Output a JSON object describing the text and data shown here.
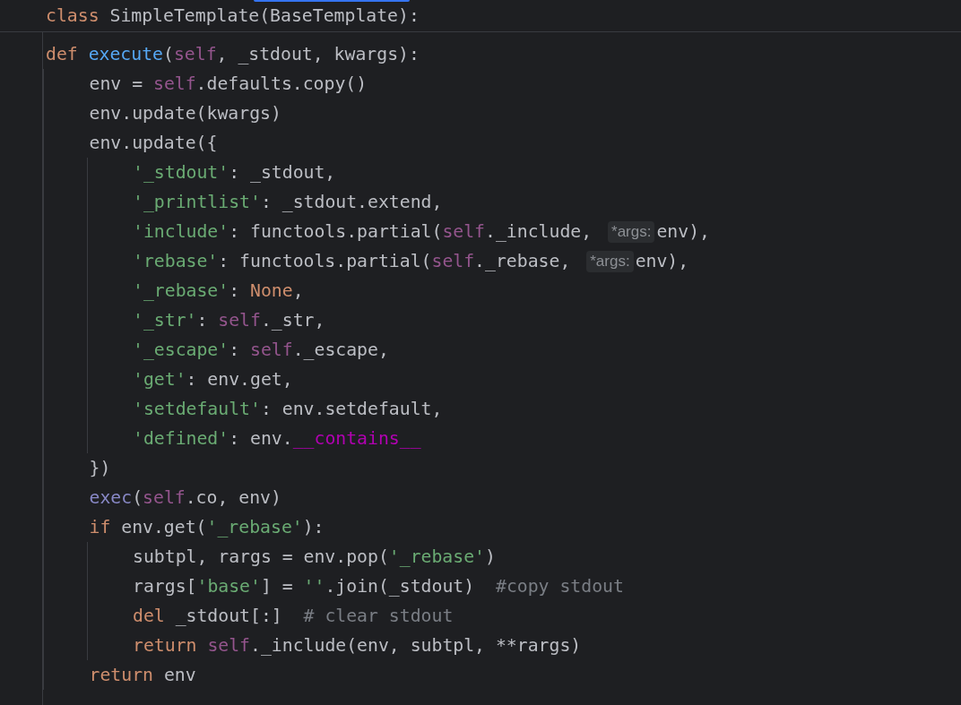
{
  "sticky_header": {
    "tokens": [
      {
        "kind": "kw",
        "text": "class "
      },
      {
        "kind": "plain",
        "text": "SimpleTemplate(BaseTemplate):"
      }
    ]
  },
  "code": [
    {
      "tokens": [
        {
          "kind": "kw",
          "text": "def "
        },
        {
          "kind": "fn",
          "text": "execute"
        },
        {
          "kind": "plain",
          "text": "("
        },
        {
          "kind": "self",
          "text": "self"
        },
        {
          "kind": "plain",
          "text": ", _stdout, kwargs):"
        }
      ],
      "children": [
        {
          "tokens": [
            {
              "kind": "plain",
              "text": "env = "
            },
            {
              "kind": "self",
              "text": "self"
            },
            {
              "kind": "plain",
              "text": ".defaults.copy()"
            }
          ]
        },
        {
          "tokens": [
            {
              "kind": "plain",
              "text": "env.update(kwargs)"
            }
          ]
        },
        {
          "tokens": [
            {
              "kind": "plain",
              "text": "env.update({"
            }
          ],
          "children": [
            {
              "tokens": [
                {
                  "kind": "str",
                  "text": "'_stdout'"
                },
                {
                  "kind": "plain",
                  "text": ": _stdout,"
                }
              ]
            },
            {
              "tokens": [
                {
                  "kind": "str",
                  "text": "'_printlist'"
                },
                {
                  "kind": "plain",
                  "text": ": _stdout.extend,"
                }
              ]
            },
            {
              "tokens": [
                {
                  "kind": "str",
                  "text": "'include'"
                },
                {
                  "kind": "plain",
                  "text": ": functools.partial("
                },
                {
                  "kind": "self",
                  "text": "self"
                },
                {
                  "kind": "plain",
                  "text": "._include, "
                },
                {
                  "kind": "hint",
                  "text": "*args:"
                },
                {
                  "kind": "plain",
                  "text": "env),"
                }
              ]
            },
            {
              "tokens": [
                {
                  "kind": "str",
                  "text": "'rebase'"
                },
                {
                  "kind": "plain",
                  "text": ": functools.partial("
                },
                {
                  "kind": "self",
                  "text": "self"
                },
                {
                  "kind": "plain",
                  "text": "._rebase, "
                },
                {
                  "kind": "hint",
                  "text": "*args:"
                },
                {
                  "kind": "plain",
                  "text": "env),"
                }
              ]
            },
            {
              "tokens": [
                {
                  "kind": "str",
                  "text": "'_rebase'"
                },
                {
                  "kind": "plain",
                  "text": ": "
                },
                {
                  "kind": "kw",
                  "text": "None"
                },
                {
                  "kind": "plain",
                  "text": ","
                }
              ]
            },
            {
              "tokens": [
                {
                  "kind": "str",
                  "text": "'_str'"
                },
                {
                  "kind": "plain",
                  "text": ": "
                },
                {
                  "kind": "self",
                  "text": "self"
                },
                {
                  "kind": "plain",
                  "text": "._str,"
                }
              ]
            },
            {
              "tokens": [
                {
                  "kind": "str",
                  "text": "'_escape'"
                },
                {
                  "kind": "plain",
                  "text": ": "
                },
                {
                  "kind": "self",
                  "text": "self"
                },
                {
                  "kind": "plain",
                  "text": "._escape,"
                }
              ]
            },
            {
              "tokens": [
                {
                  "kind": "str",
                  "text": "'get'"
                },
                {
                  "kind": "plain",
                  "text": ": env.get,"
                }
              ]
            },
            {
              "tokens": [
                {
                  "kind": "str",
                  "text": "'setdefault'"
                },
                {
                  "kind": "plain",
                  "text": ": env.setdefault,"
                }
              ]
            },
            {
              "tokens": [
                {
                  "kind": "str",
                  "text": "'defined'"
                },
                {
                  "kind": "plain",
                  "text": ": env."
                },
                {
                  "kind": "dunder",
                  "text": "__contains__"
                }
              ]
            }
          ]
        },
        {
          "tokens": [
            {
              "kind": "plain",
              "text": "})"
            }
          ]
        },
        {
          "tokens": [
            {
              "kind": "builtin",
              "text": "exec"
            },
            {
              "kind": "plain",
              "text": "("
            },
            {
              "kind": "self",
              "text": "self"
            },
            {
              "kind": "plain",
              "text": ".co, env)"
            }
          ]
        },
        {
          "tokens": [
            {
              "kind": "kw",
              "text": "if "
            },
            {
              "kind": "plain",
              "text": "env.get("
            },
            {
              "kind": "str",
              "text": "'_rebase'"
            },
            {
              "kind": "plain",
              "text": "):"
            }
          ],
          "children": [
            {
              "tokens": [
                {
                  "kind": "plain",
                  "text": "subtpl, rargs = env.pop("
                },
                {
                  "kind": "str",
                  "text": "'_rebase'"
                },
                {
                  "kind": "plain",
                  "text": ")"
                }
              ]
            },
            {
              "tokens": [
                {
                  "kind": "plain",
                  "text": "rargs["
                },
                {
                  "kind": "str",
                  "text": "'base'"
                },
                {
                  "kind": "plain",
                  "text": "] = "
                },
                {
                  "kind": "str",
                  "text": "''"
                },
                {
                  "kind": "plain",
                  "text": ".join(_stdout)  "
                },
                {
                  "kind": "comment",
                  "text": "#copy stdout"
                }
              ]
            },
            {
              "tokens": [
                {
                  "kind": "kw",
                  "text": "del "
                },
                {
                  "kind": "plain",
                  "text": "_stdout[:]  "
                },
                {
                  "kind": "comment",
                  "text": "# clear stdout"
                }
              ]
            },
            {
              "tokens": [
                {
                  "kind": "kw",
                  "text": "return "
                },
                {
                  "kind": "self",
                  "text": "self"
                },
                {
                  "kind": "plain",
                  "text": "._include(env, subtpl, **rargs)"
                }
              ]
            }
          ]
        },
        {
          "tokens": [
            {
              "kind": "kw",
              "text": "return "
            },
            {
              "kind": "plain",
              "text": "env"
            }
          ]
        }
      ]
    }
  ]
}
